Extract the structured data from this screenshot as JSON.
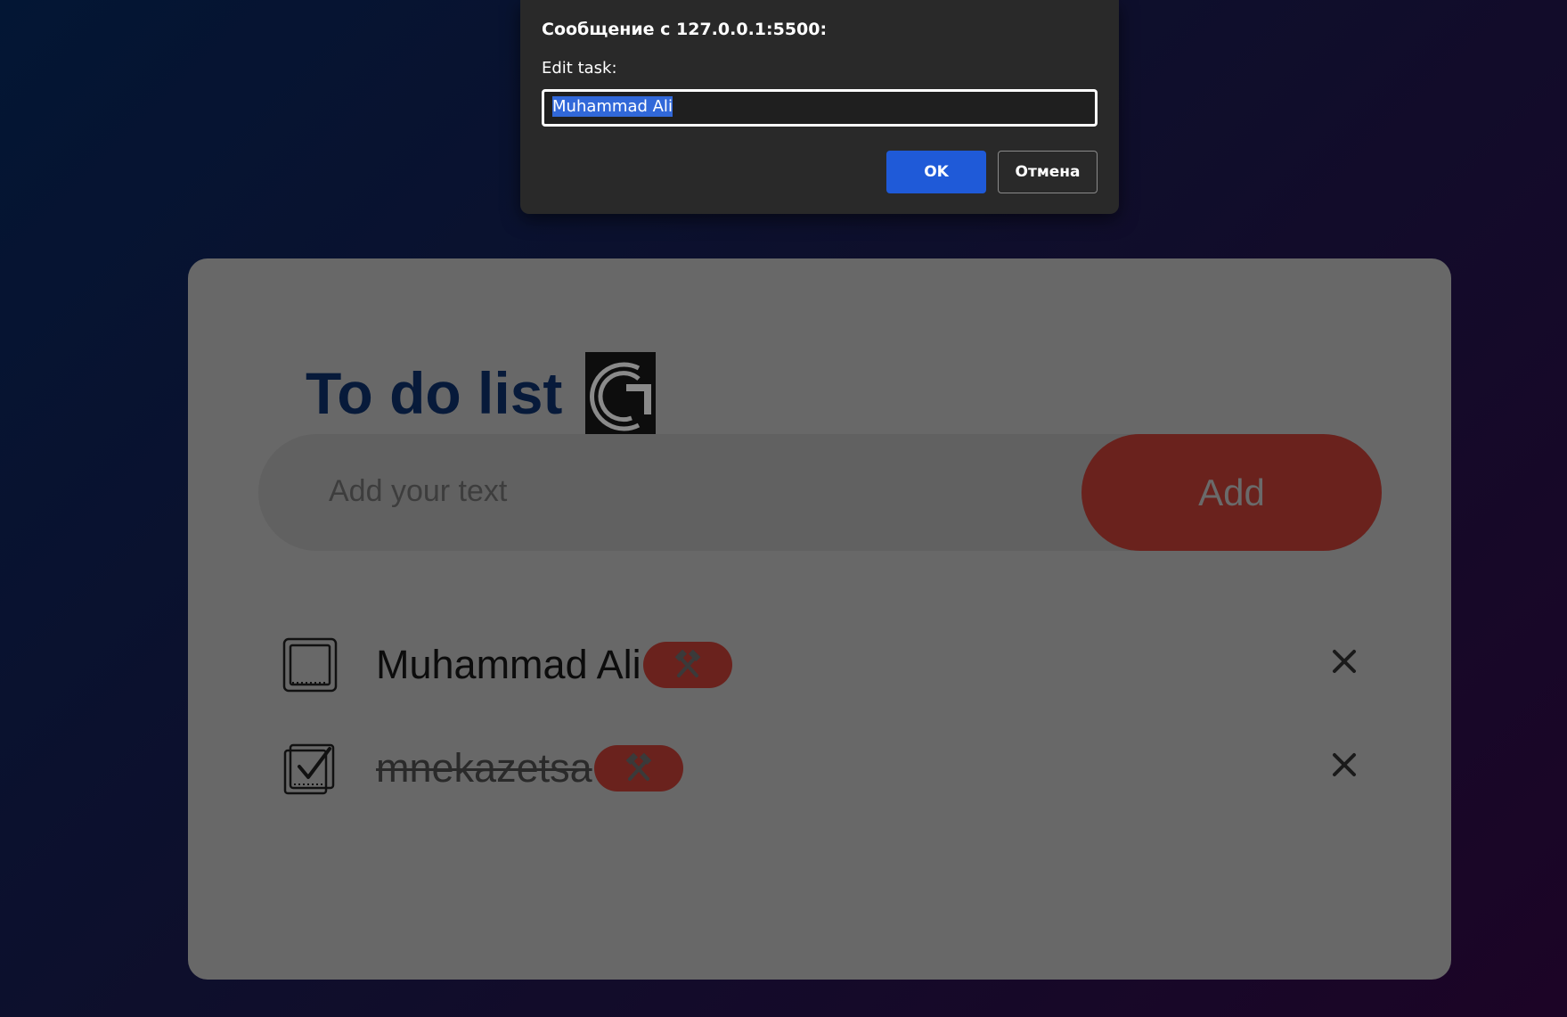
{
  "dialog": {
    "title": "Сообщение с 127.0.0.1:5500:",
    "message": "Edit task:",
    "input_value": "Muhammad Ali",
    "ok_label": "OK",
    "cancel_label": "Отмена",
    "accent_color": "#1f5ad8"
  },
  "app": {
    "title": "To do list",
    "logo_icon": "logo-icon",
    "input_placeholder": "Add your text",
    "add_label": "Add",
    "accent_color": "#6a221d"
  },
  "tasks": [
    {
      "text": "Muhammad Ali",
      "completed": false,
      "edit_icon": "hammer-pick-icon",
      "delete_icon": "close-icon"
    },
    {
      "text": "mnekazetsa",
      "completed": true,
      "edit_icon": "hammer-pick-icon",
      "delete_icon": "close-icon"
    }
  ]
}
